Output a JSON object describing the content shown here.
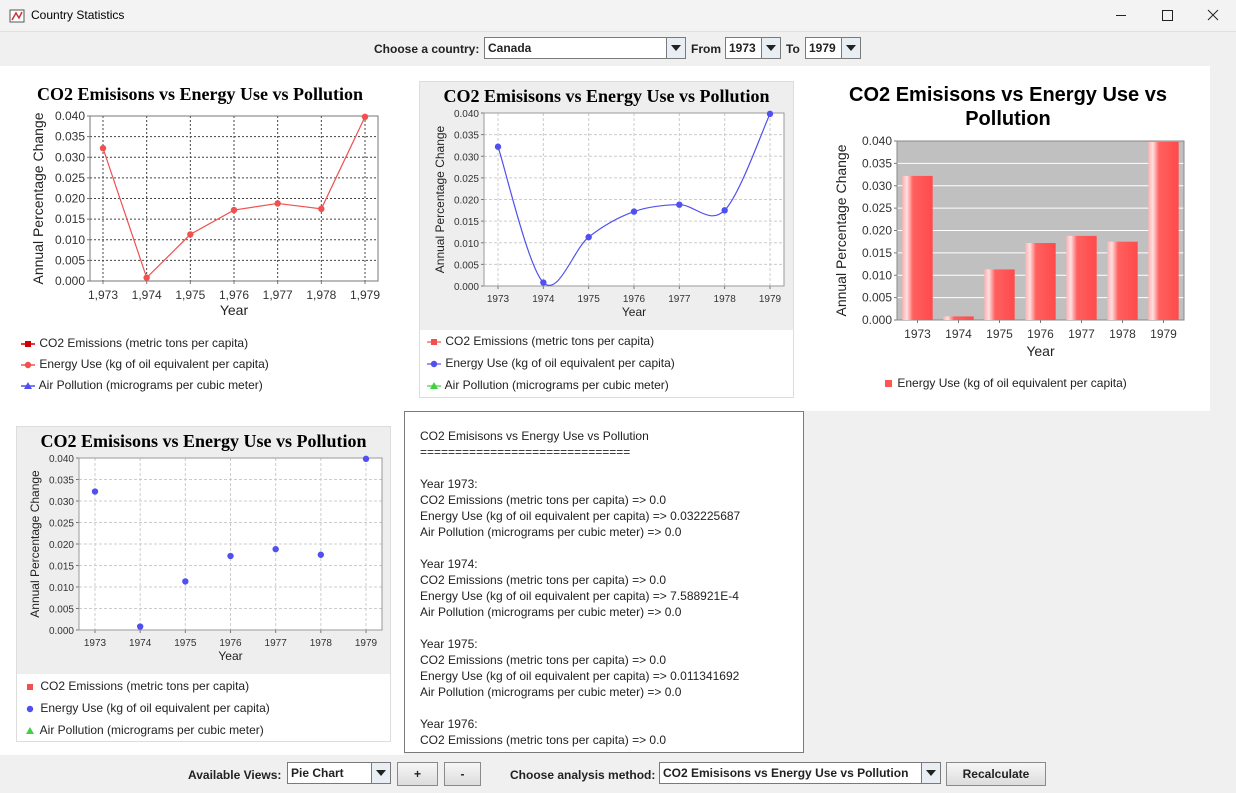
{
  "window": {
    "title": "Country Statistics"
  },
  "controls": {
    "country_label": "Choose a country:",
    "country": "Canada",
    "from_label": "From",
    "from_year": "1973",
    "to_label": "To",
    "to_year": "1979"
  },
  "charts": {
    "title": "CO2 Emisisons vs Energy Use vs Pollution",
    "bar_title_line1": "CO2 Emisisons vs Energy Use vs",
    "bar_title_line2": "Pollution",
    "xlabel": "Year",
    "ylabel": "Annual Percentage Change",
    "legend": {
      "co2": "CO2 Emissions (metric tons per capita)",
      "energy": "Energy Use (kg of oil equivalent per capita)",
      "air": "Air Pollution (micrograms per cubic meter)"
    }
  },
  "chart_data": [
    {
      "type": "line",
      "title": "CO2 Emisisons vs Energy Use vs Pollution",
      "xlabel": "Year",
      "ylabel": "Annual Percentage Change",
      "x": [
        "1,973",
        "1,974",
        "1,975",
        "1,976",
        "1,977",
        "1,978",
        "1,979"
      ],
      "series": [
        {
          "name": "Energy Use (kg of oil equivalent per capita)",
          "values": [
            0.0322,
            0.0008,
            0.0113,
            0.0172,
            0.0188,
            0.0175,
            0.0398
          ]
        }
      ],
      "ylim": [
        0,
        0.04
      ],
      "yticks": [
        "0.000",
        "0.005",
        "0.010",
        "0.015",
        "0.020",
        "0.025",
        "0.030",
        "0.035",
        "0.040"
      ],
      "grid": true,
      "legend": "bottom"
    },
    {
      "type": "line",
      "title": "CO2 Emisisons vs Energy Use vs Pollution",
      "xlabel": "Year",
      "ylabel": "Annual Percentage Change",
      "x": [
        "1973",
        "1974",
        "1975",
        "1976",
        "1977",
        "1978",
        "1979"
      ],
      "series": [
        {
          "name": "Energy Use (kg of oil equivalent per capita)",
          "values": [
            0.0322,
            0.0008,
            0.0113,
            0.0172,
            0.0188,
            0.0175,
            0.0398
          ]
        }
      ],
      "ylim": [
        0,
        0.04
      ],
      "yticks": [
        "0.000",
        "0.005",
        "0.010",
        "0.015",
        "0.020",
        "0.025",
        "0.030",
        "0.035",
        "0.040"
      ],
      "grid": true,
      "legend": "bottom",
      "smooth": true
    },
    {
      "type": "bar",
      "title": "CO2 Emisisons vs Energy Use vs Pollution",
      "xlabel": "Year",
      "ylabel": "Annual Percentage Change",
      "categories": [
        "1973",
        "1974",
        "1975",
        "1976",
        "1977",
        "1978",
        "1979"
      ],
      "series": [
        {
          "name": "Energy Use (kg of oil equivalent per capita)",
          "values": [
            0.0322,
            0.0008,
            0.0113,
            0.0172,
            0.0188,
            0.0175,
            0.0398
          ]
        }
      ],
      "ylim": [
        0,
        0.04
      ],
      "yticks": [
        "0.000",
        "0.005",
        "0.010",
        "0.015",
        "0.020",
        "0.025",
        "0.030",
        "0.035",
        "0.040"
      ],
      "legend": "bottom"
    },
    {
      "type": "scatter",
      "title": "CO2 Emisisons vs Energy Use vs Pollution",
      "xlabel": "Year",
      "ylabel": "Annual Percentage Change",
      "x": [
        "1973",
        "1974",
        "1975",
        "1976",
        "1977",
        "1978",
        "1979"
      ],
      "series": [
        {
          "name": "Energy Use (kg of oil equivalent per capita)",
          "values": [
            0.0322,
            0.0008,
            0.0113,
            0.0172,
            0.0188,
            0.0175,
            0.0398
          ]
        }
      ],
      "ylim": [
        0,
        0.04
      ],
      "yticks": [
        "0.000",
        "0.005",
        "0.010",
        "0.015",
        "0.020",
        "0.025",
        "0.030",
        "0.035",
        "0.040"
      ],
      "grid": true,
      "legend": "bottom"
    }
  ],
  "report": {
    "lines": [
      "CO2 Emisisons vs Energy Use vs Pollution",
      "==============================",
      "",
      "Year 1973:",
      "CO2 Emissions (metric tons per capita) => 0.0",
      "Energy Use (kg of oil equivalent per capita) => 0.032225687",
      "Air Pollution (micrograms per cubic meter) => 0.0",
      "",
      "Year 1974:",
      "CO2 Emissions (metric tons per capita) => 0.0",
      "Energy Use (kg of oil equivalent per capita) => 7.588921E-4",
      "Air Pollution (micrograms per cubic meter) => 0.0",
      "",
      "Year 1975:",
      "CO2 Emissions (metric tons per capita) => 0.0",
      "Energy Use (kg of oil equivalent per capita) => 0.011341692",
      "Air Pollution (micrograms per cubic meter) => 0.0",
      "",
      "Year 1976:",
      "CO2 Emissions (metric tons per capita) => 0.0"
    ]
  },
  "bottom": {
    "views_label": "Available Views:",
    "view": "Pie Chart",
    "add": "+",
    "remove": "-",
    "method_label": "Choose analysis method:",
    "method": "CO2 Emisisons vs Energy Use vs Pollution",
    "recalc": "Recalculate"
  }
}
